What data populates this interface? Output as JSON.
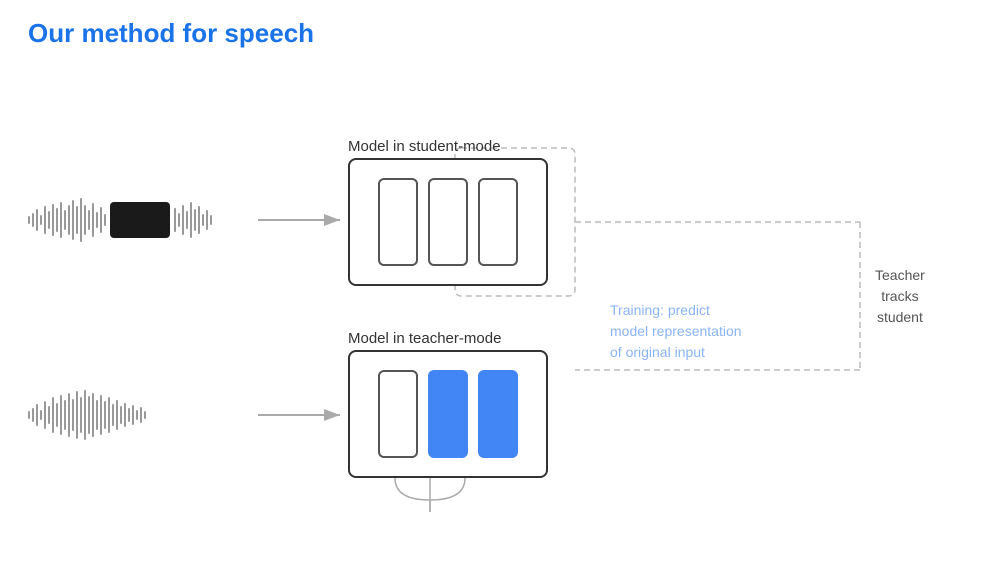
{
  "title": "Our method for speech",
  "student_model_label": "Model in student-mode",
  "teacher_model_label": "Model in teacher-mode",
  "training_text": "Training: predict\nmodel representation\nof original input",
  "teacher_tracks_text": "Teacher\ntracks\nstudent",
  "colors": {
    "title": "#1a73e8",
    "blue": "#4285f4",
    "dashed": "#aaa",
    "arrow": "#aaa",
    "training_text": "#8ab4f8"
  }
}
